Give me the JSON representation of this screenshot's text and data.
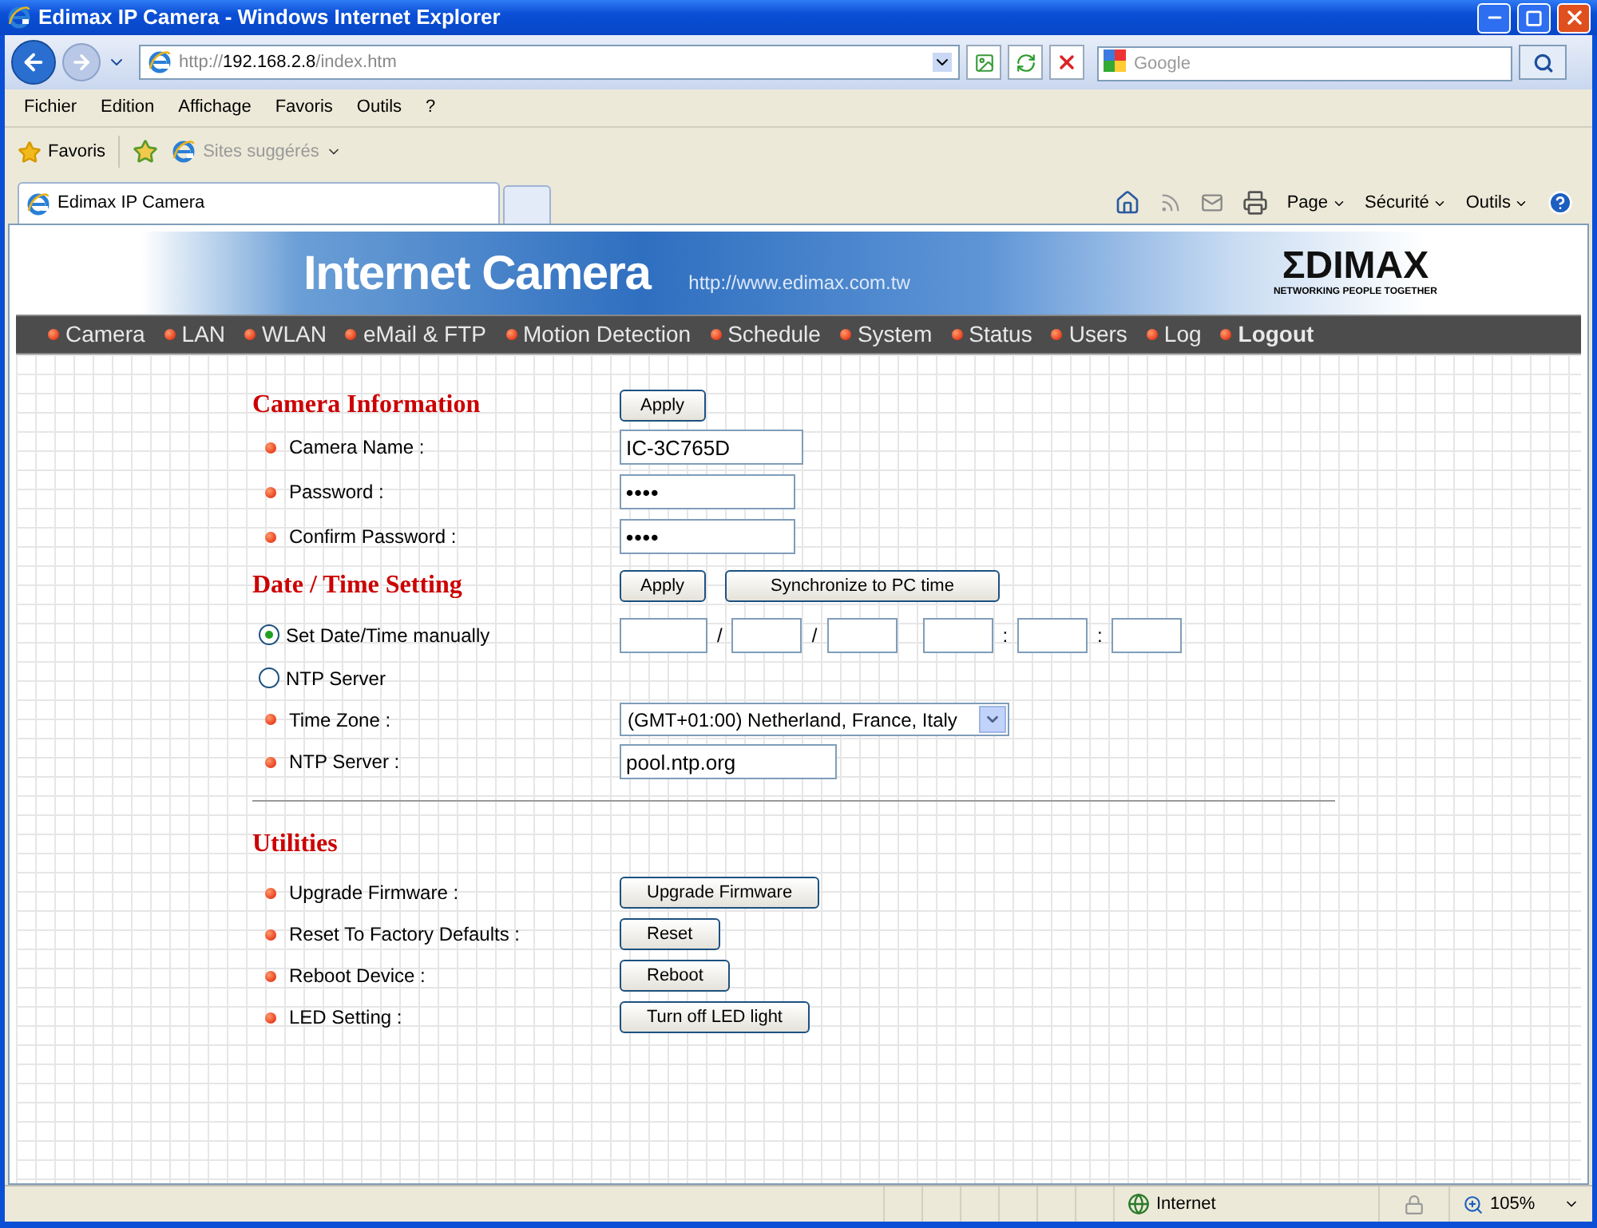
{
  "window": {
    "title": "Edimax IP Camera - Windows Internet Explorer"
  },
  "address": {
    "scheme": "http://",
    "host": "192.168.2.8",
    "path": "/index.htm"
  },
  "search": {
    "placeholder": "Google"
  },
  "menu": [
    "Fichier",
    "Edition",
    "Affichage",
    "Favoris",
    "Outils",
    "?"
  ],
  "favorites_bar": {
    "favorites": "Favoris",
    "suggested": "Sites suggérés"
  },
  "tabs": [
    {
      "label": "Edimax IP Camera",
      "selected": true
    }
  ],
  "command_bar": [
    "Page",
    "Sécurité",
    "Outils"
  ],
  "banner": {
    "title": "Internet Camera",
    "url": "http://www.edimax.com.tw",
    "logo": "ΣDIMAX",
    "tagline": "NETWORKING PEOPLE TOGETHER"
  },
  "nav": [
    {
      "label": "Camera",
      "bold": false
    },
    {
      "label": "LAN",
      "bold": false
    },
    {
      "label": "WLAN",
      "bold": false
    },
    {
      "label": "eMail & FTP",
      "bold": false
    },
    {
      "label": "Motion Detection",
      "bold": false
    },
    {
      "label": "Schedule",
      "bold": false
    },
    {
      "label": "System",
      "bold": false
    },
    {
      "label": "Status",
      "bold": false
    },
    {
      "label": "Users",
      "bold": false
    },
    {
      "label": "Log",
      "bold": false
    },
    {
      "label": "Logout",
      "bold": true
    }
  ],
  "camera_information": {
    "title": "Camera Information",
    "apply": "Apply",
    "fields": [
      {
        "label": "Camera Name :",
        "value": "IC-3C765D",
        "kind": "text"
      },
      {
        "label": "Password :",
        "value": "••••",
        "kind": "password"
      },
      {
        "label": "Confirm Password :",
        "value": "••••",
        "kind": "password"
      }
    ]
  },
  "date_time": {
    "title": "Date / Time Setting",
    "apply": "Apply",
    "sync": "Synchronize to PC time",
    "modes": [
      {
        "label": "Set Date/Time manually",
        "selected": true
      },
      {
        "label": "NTP Server",
        "selected": false
      }
    ],
    "date_separators": [
      "/",
      "/"
    ],
    "time_separators": [
      ":",
      ":"
    ],
    "time_zone": {
      "label": "Time Zone :",
      "value": "(GMT+01:00) Netherland, France, Italy"
    },
    "ntp_server": {
      "label": "NTP Server :",
      "value": "pool.ntp.org"
    }
  },
  "utilities": {
    "title": "Utilities",
    "rows": [
      {
        "label": "Upgrade Firmware :",
        "button": "Upgrade Firmware"
      },
      {
        "label": "Reset To Factory Defaults :",
        "button": "Reset"
      },
      {
        "label": "Reboot Device :",
        "button": "Reboot"
      },
      {
        "label": "LED Setting :",
        "button": "Turn off LED light"
      }
    ]
  },
  "status_bar": {
    "zone": "Internet",
    "zoom": "105%"
  }
}
